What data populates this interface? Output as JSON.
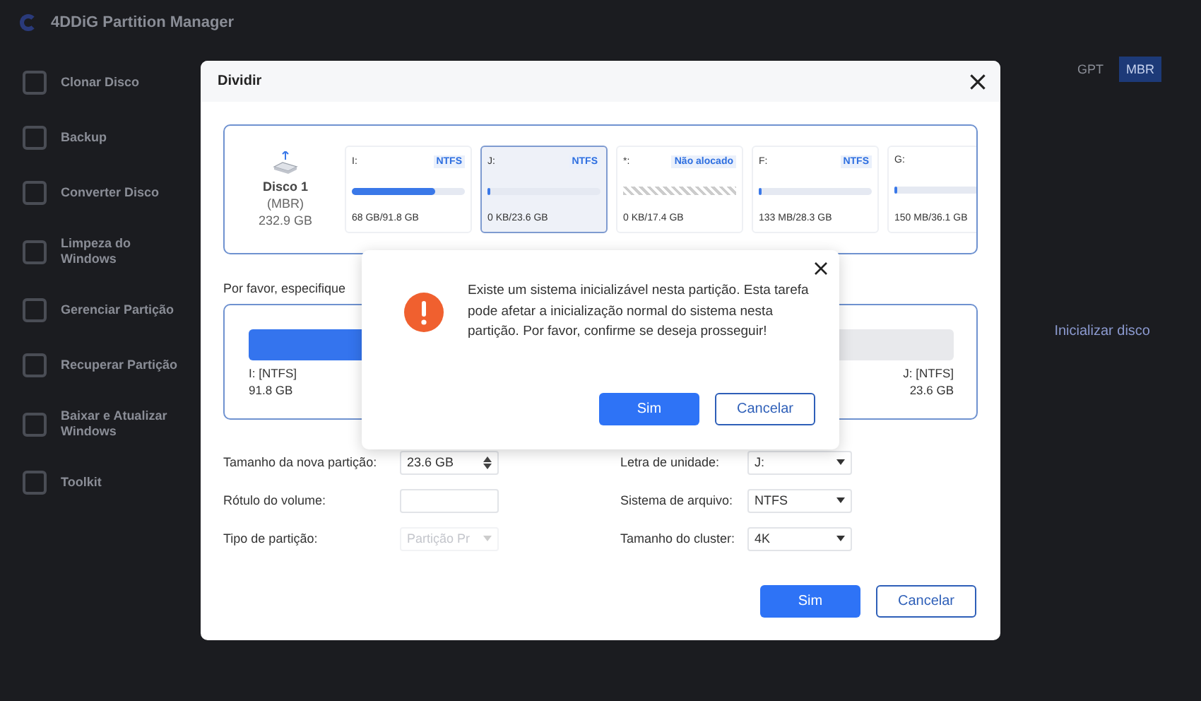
{
  "app": {
    "title": "4DDiG Partition Manager",
    "sidebar": [
      {
        "label": "Clonar Disco"
      },
      {
        "label": "Backup"
      },
      {
        "label": "Converter Disco"
      },
      {
        "label": "Limpeza do Windows"
      },
      {
        "label": "Gerenciar Partição"
      },
      {
        "label": "Recuperar Partição"
      },
      {
        "label": "Baixar e Atualizar Windows"
      },
      {
        "label": "Toolkit"
      }
    ],
    "style_toggle": [
      {
        "label": "GPT",
        "selected": false
      },
      {
        "label": "MBR",
        "selected": true
      }
    ],
    "init_button": "Inicializar disco"
  },
  "dialog": {
    "title": "Dividir",
    "disk": {
      "name": "Disco 1",
      "style": "(MBR)",
      "size": "232.9 GB"
    },
    "partitions": [
      {
        "kind": "normal",
        "letter": "I:",
        "fs": "NTFS",
        "level": 0.74,
        "usage": "68 GB/91.8 GB",
        "selected": false
      },
      {
        "kind": "normal",
        "letter": "J:",
        "fs": "NTFS",
        "level": 0.02,
        "usage": "0 KB/23.6 GB",
        "selected": true
      },
      {
        "kind": "unallocated",
        "letter": "*:",
        "fs": "Não alocado",
        "usage": "0 KB/17.4 GB",
        "selected": false
      },
      {
        "kind": "normal",
        "letter": "F:",
        "fs": "NTFS",
        "level": 0.02,
        "usage": "133 MB/28.3 GB",
        "selected": false
      },
      {
        "kind": "normal",
        "letter": "G:",
        "level": 0.02,
        "usage": "150 MB/36.1 GB",
        "selected": false
      }
    ],
    "instruction": "Por favor, especifique",
    "split": {
      "level": 0.8,
      "left_name": "I: [NTFS]",
      "left_size": "91.8 GB",
      "right_name": "J: [NTFS]",
      "right_size": "23.6 GB"
    },
    "fields_left": [
      {
        "kind": "spinner",
        "label": "Tamanho da nova partição:",
        "value": "23.6  GB",
        "disabled": false
      },
      {
        "kind": "text",
        "label": "Rótulo do volume:",
        "disabled": false
      },
      {
        "kind": "select",
        "label": "Tipo de partição:",
        "value": "Partição Pr",
        "disabled": true
      }
    ],
    "fields_right": [
      {
        "kind": "select",
        "label": "Letra de unidade:",
        "value": "J:",
        "disabled": false
      },
      {
        "kind": "select",
        "label": "Sistema de arquivo:",
        "value": "NTFS",
        "disabled": false
      },
      {
        "kind": "select",
        "label": "Tamanho do cluster:",
        "value": "4K",
        "disabled": false
      }
    ],
    "buttons": [
      {
        "kind": "primary",
        "label": "Sim"
      },
      {
        "kind": "secondary",
        "label": "Cancelar"
      }
    ]
  },
  "alert": {
    "message": "Existe um sistema inicializável nesta partição. Esta tarefa pode afetar a inicialização normal do sistema nesta partição. Por favor, confirme se deseja prosseguir!",
    "buttons": [
      {
        "kind": "primary",
        "label": "Sim"
      },
      {
        "kind": "secondary",
        "label": "Cancelar"
      }
    ]
  }
}
